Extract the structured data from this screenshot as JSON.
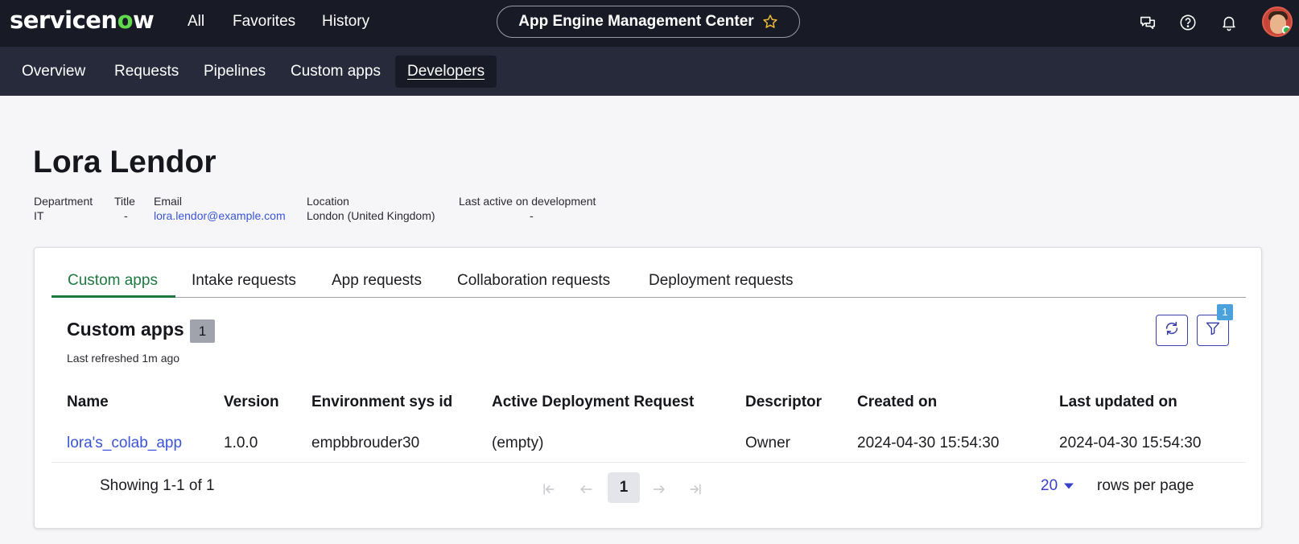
{
  "topbar": {
    "logo_prefix": "servicen",
    "logo_o": "o",
    "logo_suffix": "w",
    "nav": [
      "All",
      "Favorites",
      "History"
    ],
    "context_title": "App Engine Management Center"
  },
  "subnav": {
    "tabs": [
      "Overview",
      "Requests",
      "Pipelines",
      "Custom apps",
      "Developers"
    ],
    "active": "Developers"
  },
  "profile": {
    "name": "Lora Lendor",
    "fields": [
      {
        "label": "Department",
        "value": "IT"
      },
      {
        "label": "Title",
        "value": "-"
      },
      {
        "label": "Email",
        "value": "lora.lendor@example.com"
      },
      {
        "label": "Location",
        "value": "London (United Kingdom)"
      },
      {
        "label": "Last active on development",
        "value": "-"
      }
    ]
  },
  "card": {
    "tabs": [
      "Custom apps",
      "Intake requests",
      "App requests",
      "Collaboration requests",
      "Deployment requests"
    ],
    "active_tab": "Custom apps",
    "section_title": "Custom apps",
    "count": "1",
    "last_refreshed": "Last refreshed 1m ago",
    "filter_badge": "1",
    "table": {
      "columns": [
        "Name",
        "Version",
        "Environment sys id",
        "Active Deployment Request",
        "Descriptor",
        "Created on",
        "Last updated on"
      ],
      "rows": [
        [
          "lora's_colab_app",
          "1.0.0",
          "empbbrouder30",
          "(empty)",
          "Owner",
          "2024-04-30 15:54:30",
          "2024-04-30 15:54:30"
        ]
      ]
    },
    "pagination": {
      "showing": "Showing 1-1 of 1",
      "current_page": "1",
      "rows_per_page_value": "20",
      "rows_per_page_label": "rows per page"
    }
  },
  "colors": {
    "topbar_bg": "#181a25",
    "subbar_bg": "#262a3b",
    "accent_green": "#1c7a3f",
    "link_blue": "#3a55d8",
    "logo_green": "#62d84e"
  },
  "icons": [
    "star-icon",
    "chat-icon",
    "help-icon",
    "bell-icon",
    "refresh-icon",
    "filter-icon",
    "first-page-icon",
    "prev-page-icon",
    "next-page-icon",
    "last-page-icon",
    "caret-down-icon"
  ]
}
